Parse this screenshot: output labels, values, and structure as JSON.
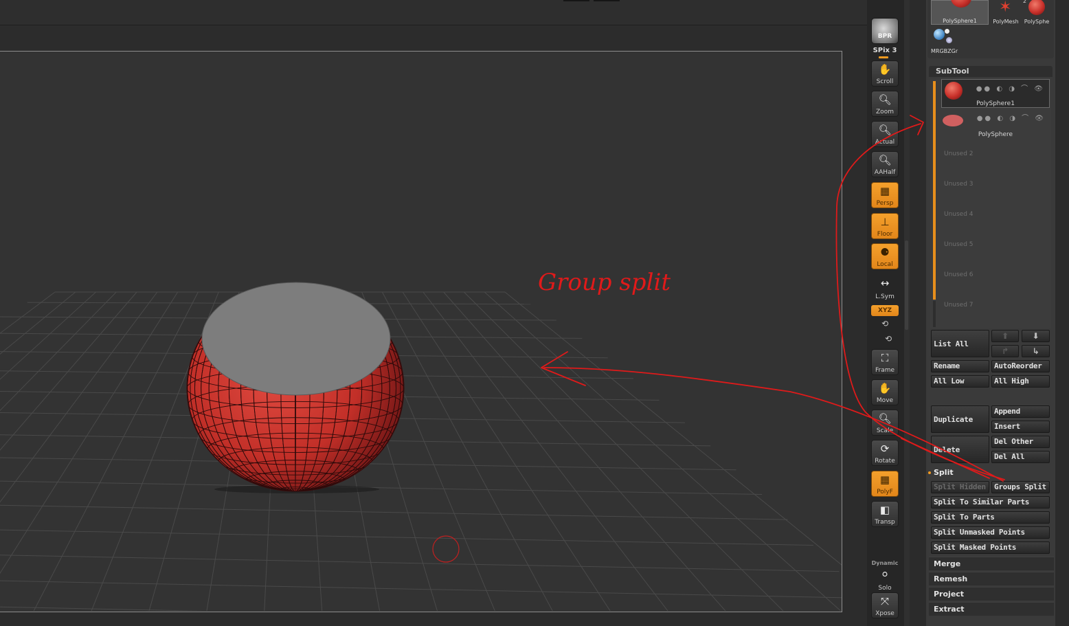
{
  "tool_palette": {
    "thumbs": [
      {
        "label": "PolySphere1",
        "icon": "polysphere-thumbnail-icon"
      },
      {
        "label": "PolyMesh",
        "icon": "polymesh-star-icon"
      },
      {
        "label": "PolySphe",
        "icon": "polysphere-small-icon",
        "badge": "2"
      },
      {
        "label": "MRGBZGr",
        "icon": "mrgbzgrabber-icon"
      }
    ]
  },
  "shelf": {
    "bpr": "BPR",
    "spix": "SPix 3",
    "buttons": [
      {
        "label": "Scroll",
        "icon": "hand-icon",
        "active": false
      },
      {
        "label": "Zoom",
        "icon": "magnifier-icon",
        "active": false
      },
      {
        "label": "Actual",
        "icon": "magnifier-actual-icon",
        "active": false
      },
      {
        "label": "AAHalf",
        "icon": "magnifier-aahalf-icon",
        "active": false
      },
      {
        "label": "Persp",
        "icon": "perspective-grid-icon",
        "active": true
      },
      {
        "label": "Floor",
        "icon": "floor-icon",
        "active": true
      },
      {
        "label": "Local",
        "icon": "local-transform-icon",
        "active": true
      },
      {
        "label": "L.Sym",
        "icon": "local-symmetry-icon",
        "active": false
      },
      {
        "label": "Frame",
        "icon": "frame-icon",
        "active": false
      },
      {
        "label": "Move",
        "icon": "move-hand-icon",
        "active": false
      },
      {
        "label": "Scale",
        "icon": "scale-icon",
        "active": false
      },
      {
        "label": "Rotate",
        "icon": "rotate-icon",
        "active": false
      },
      {
        "label": "PolyF",
        "icon": "polyframe-icon",
        "active": true
      },
      {
        "label": "Transp",
        "icon": "transparency-icon",
        "active": false
      },
      {
        "label": "Solo",
        "icon": "solo-icon",
        "active": false
      },
      {
        "label": "Xpose",
        "icon": "xpose-icon",
        "active": false
      }
    ],
    "xyz": "XYZ",
    "dynamic": "Dynamic"
  },
  "subtool": {
    "title": "SubTool",
    "items": [
      {
        "name": "PolySphere1",
        "selected": true
      },
      {
        "name": "PolySphere",
        "selected": false
      }
    ],
    "unused": [
      "Unused 2",
      "Unused 3",
      "Unused 4",
      "Unused 5",
      "Unused 6",
      "Unused 7"
    ],
    "list_all": "List All",
    "rename": "Rename",
    "autoreorder": "AutoReorder",
    "all_low": "All Low",
    "all_high": "All High",
    "duplicate": "Duplicate",
    "append": "Append",
    "insert": "Insert",
    "delete": "Delete",
    "del_other": "Del Other",
    "del_all": "Del All"
  },
  "split": {
    "label": "Split",
    "split_hidden": "Split Hidden",
    "groups_split": "Groups Split",
    "similar": "Split To Similar Parts",
    "parts": "Split To Parts",
    "unmasked": "Split Unmasked Points",
    "masked": "Split Masked Points"
  },
  "sections": [
    "Merge",
    "Remesh",
    "Project",
    "Extract"
  ],
  "annotation": {
    "text": "Group split",
    "color": "#e01a1a"
  },
  "colors": {
    "accent_orange": "#e88f1c",
    "mesh_red": "#c8302a",
    "cap_gray": "#7d7d7d"
  }
}
